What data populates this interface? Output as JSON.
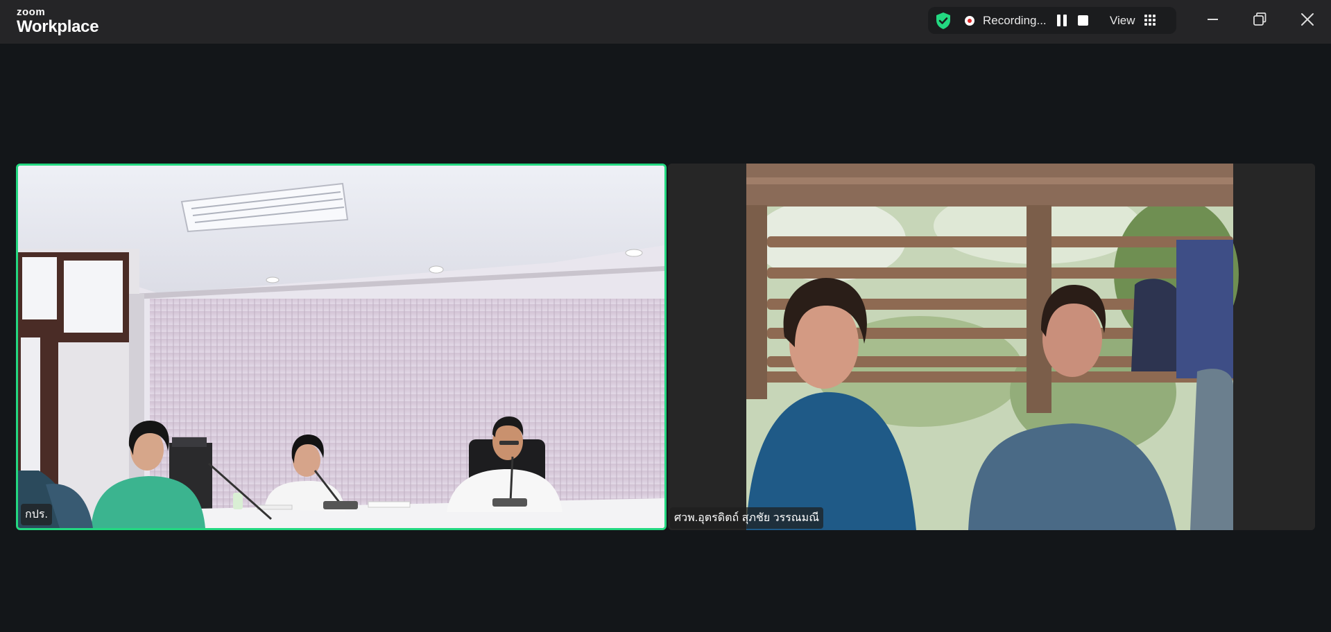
{
  "app": {
    "logo_top": "zoom",
    "logo_bottom": "Workplace"
  },
  "recording": {
    "status": "Recording...",
    "view_label": "View"
  },
  "icons": {
    "encryption": "shield-check-icon",
    "record": "record-dot-icon",
    "pause": "pause-icon",
    "stop": "stop-icon",
    "view": "grid-icon",
    "minimize": "minimize-icon",
    "restore": "restore-icon",
    "close": "close-icon"
  },
  "colors": {
    "active_speaker_border": "#23d881",
    "shield": "#23d881",
    "record_dot": "#e02828",
    "titlebar": "#252527",
    "background": "#131619"
  },
  "participants": [
    {
      "name": "กปร.",
      "active_speaker": true
    },
    {
      "name": "ศวพ.อุตรดิตถ์ สุภชัย วรรณมณี",
      "active_speaker": false
    }
  ]
}
